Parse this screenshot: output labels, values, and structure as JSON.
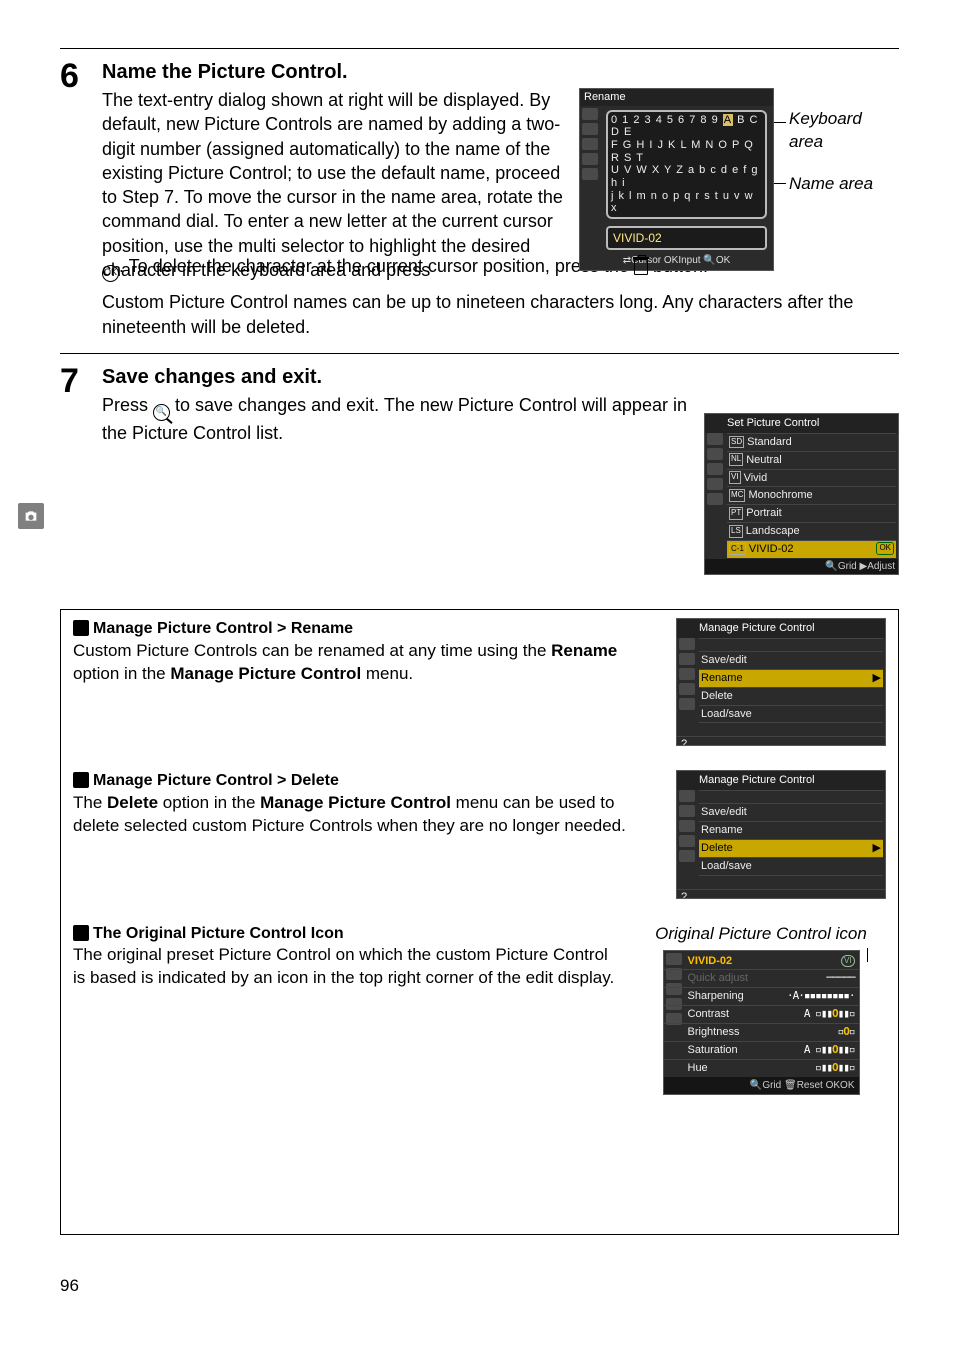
{
  "page_number": "96",
  "step6": {
    "num": "6",
    "title": "Name the Picture Control.",
    "para1": "The text-entry dialog shown at right will be displayed.  By default, new Picture Controls are named by adding a two-digit number (assigned automatically) to the name of the existing Picture Control; to use the default name, proceed to Step 7.  To move the cursor in the name area, rotate the command dial.  To enter a new letter at the current cursor position, use the multi selector to highlight the desired character in the keyboard area and press ",
    "para1b": ".  To delete the character at the current cursor position, press the ",
    "para1c": " button.",
    "para2": "Custom Picture Control names can be up to nineteen characters long.  Any characters after the nineteenth will be deleted.",
    "rename_title": "Rename",
    "kbd_rowA": "0 1 2 3 4 5 6 7 8 9",
    "kbd_rowA_hl": "A",
    "kbd_rowA_rest": "B C D E",
    "kbd_rowB": "F G H I J K L M N O P Q R S T",
    "kbd_rowC": "U V W X Y Z a b c d e f g h i",
    "kbd_rowD": "j k l m n o p q r s t u v w x",
    "name_value": "VIVID-02",
    "rename_footer": "⇄Cursor  OKInput  🔍OK",
    "callout_keyboard": "Keyboard area",
    "callout_name": "Name area"
  },
  "step7": {
    "num": "7",
    "title": "Save changes and exit.",
    "para": "Press ",
    "para_b": " to save changes and exit.  The new Picture Control will appear in the Picture Control list.",
    "pc_title": "Set Picture Control",
    "pc_items": [
      {
        "badge": "SD",
        "label": "Standard"
      },
      {
        "badge": "NL",
        "label": "Neutral"
      },
      {
        "badge": "VI",
        "label": "Vivid"
      },
      {
        "badge": "MC",
        "label": "Monochrome"
      },
      {
        "badge": "PT",
        "label": "Portrait"
      },
      {
        "badge": "LS",
        "label": "Landscape"
      },
      {
        "badge": "C-1",
        "label": "VIVID-02",
        "sel": true
      }
    ],
    "pc_footer": "🔍Grid  ▶Adjust"
  },
  "notes": {
    "rename": {
      "head": "Manage Picture Control > Rename",
      "text_a": "Custom Picture Controls can be renamed at any time using the ",
      "text_b": "Rename",
      "text_c": " option in the ",
      "text_d": "Manage Picture Control",
      "text_e": " menu.",
      "screen_title": "Manage Picture Control",
      "items": [
        "Save/edit",
        "Rename",
        "Delete",
        "Load/save"
      ],
      "sel_index": 1
    },
    "delete": {
      "head": "Manage Picture Control > Delete",
      "text_a": "The ",
      "text_b": "Delete",
      "text_c": " option in the ",
      "text_d": "Manage Picture Control",
      "text_e": " menu can be used to delete selected custom Picture Controls when they are no longer needed.",
      "screen_title": "Manage Picture Control",
      "items": [
        "Save/edit",
        "Rename",
        "Delete",
        "Load/save"
      ],
      "sel_index": 2
    },
    "original": {
      "head": "The Original Picture Control Icon",
      "text": "The original preset Picture Control on which the custom Picture Control is based is indicated by an icon in the top right corner of the edit display.",
      "fig_title": "Original Picture Control icon",
      "screen_head": "VIVID-02",
      "screen_badge": "VI",
      "rows": [
        {
          "label": "Quick adjust",
          "bars": "─────",
          "dim": true
        },
        {
          "label": "Sharpening",
          "bars": "·A·▪▪▪▪▪▪▪▪·"
        },
        {
          "label": "Contrast",
          "bars": "A ▫▮▮O▮▮▫"
        },
        {
          "label": "Brightness",
          "bars": "▫O▫"
        },
        {
          "label": "Saturation",
          "bars": "A ▫▮▮O▮▮▫"
        },
        {
          "label": "Hue",
          "bars": "▫▮▮O▮▮▫"
        }
      ],
      "footer": "🔍Grid  🗑Reset  OKOK"
    }
  }
}
